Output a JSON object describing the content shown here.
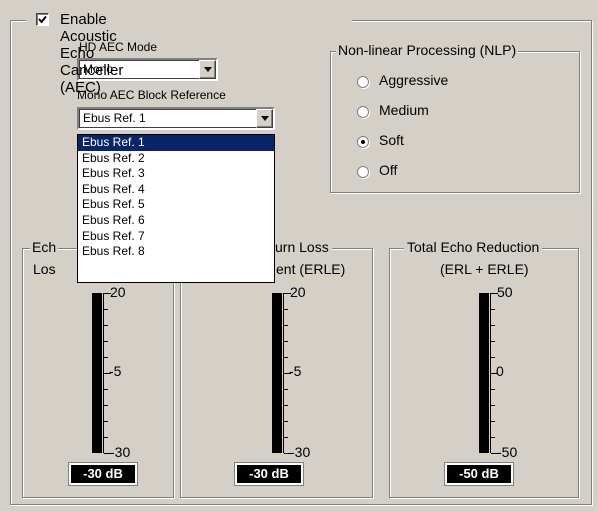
{
  "aec": {
    "enable_label": "Enable Acoustic Echo Canceller (AEC)",
    "enabled": true,
    "hd_mode_label": "HD AEC Mode",
    "hd_mode_value": "Mono",
    "block_ref_label": "Mono AEC Block Reference",
    "block_ref_value": "Ebus Ref. 1",
    "block_ref_options": [
      "Ebus Ref. 1",
      "Ebus Ref. 2",
      "Ebus Ref. 3",
      "Ebus Ref. 4",
      "Ebus Ref. 5",
      "Ebus Ref. 6",
      "Ebus Ref. 7",
      "Ebus Ref. 8"
    ],
    "block_ref_selected_index": 0
  },
  "nlp": {
    "title": "Non-linear Processing (NLP)",
    "options": [
      "Aggressive",
      "Medium",
      "Soft",
      "Off"
    ],
    "selected": "Soft"
  },
  "meters": [
    {
      "title_line1": "Ech",
      "title_line2": "Los",
      "scale_labels": [
        "20",
        "-5",
        "-30"
      ],
      "readout": "-30 dB",
      "level_db": -30
    },
    {
      "title_line1": "urn Loss",
      "title_line2": "ent (ERLE)",
      "scale_labels": [
        "20",
        "-5",
        "-30"
      ],
      "readout": "-30 dB",
      "level_db": -30
    },
    {
      "title_line1": "Total Echo Reduction",
      "title_line2": "(ERL + ERLE)",
      "scale_labels": [
        "50",
        "0",
        "-50"
      ],
      "readout": "-50 dB",
      "level_db": -50
    }
  ],
  "icons": {
    "check": "check-icon",
    "dropdown_arrow": "chevron-down-icon"
  },
  "colors": {
    "background": "#d4d0c8",
    "selection": "#0a246a",
    "readout_bg": "#000000"
  }
}
